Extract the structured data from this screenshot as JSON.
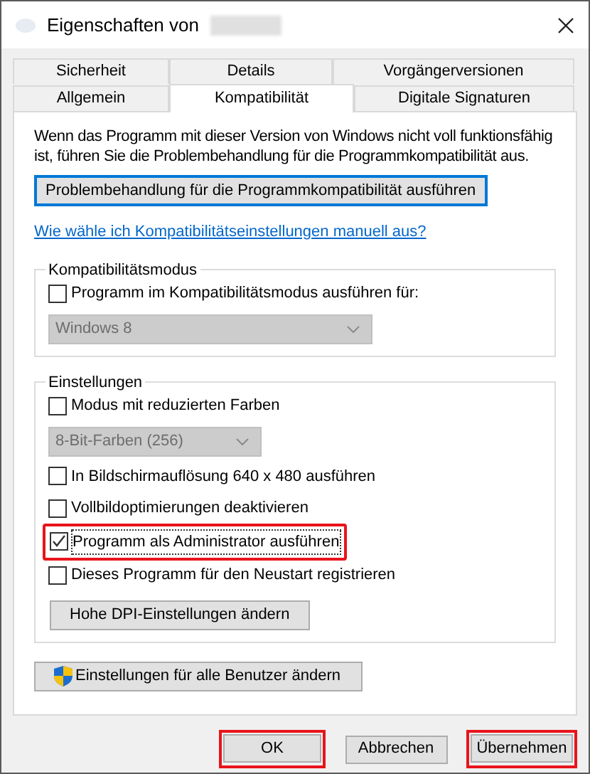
{
  "window": {
    "title": "Eigenschaften von"
  },
  "tab_rows": [
    [
      {
        "label": "Sicherheit",
        "selected": false
      },
      {
        "label": "Details",
        "selected": false
      },
      {
        "label": "Vorgängerversionen",
        "selected": false
      }
    ],
    [
      {
        "label": "Allgemein",
        "selected": false
      },
      {
        "label": "Kompatibilität",
        "selected": true
      },
      {
        "label": "Digitale Signaturen",
        "selected": false
      }
    ]
  ],
  "description": "Wenn das Programm mit dieser Version von Windows nicht voll funktionsfähig ist, führen Sie die Problembehandlung für die Programmkompatibilität aus.",
  "troubleshoot_button": "Problembehandlung für die Programmkompatibilität ausführen",
  "help_link": "Wie wähle ich Kompatibilitätseinstellungen manuell aus?",
  "groups": [
    {
      "title": "Kompatibilitätsmodus",
      "items": [
        {
          "kind": "checkbox",
          "label": "Programm im Kompatibilitätsmodus ausführen für:",
          "checked": false,
          "highlighted": false
        },
        {
          "kind": "dropdown",
          "value": "Windows 8",
          "disabled": true
        }
      ]
    },
    {
      "title": "Einstellungen",
      "items": [
        {
          "kind": "checkbox",
          "label": "Modus mit reduzierten Farben",
          "checked": false,
          "highlighted": false
        },
        {
          "kind": "dropdown",
          "value": "8-Bit-Farben (256)",
          "disabled": true
        },
        {
          "kind": "checkbox",
          "label": "In Bildschirmauflösung 640 x 480 ausführen",
          "checked": false,
          "highlighted": false
        },
        {
          "kind": "checkbox",
          "label": "Vollbildoptimierungen deaktivieren",
          "checked": false,
          "highlighted": false
        },
        {
          "kind": "checkbox",
          "label": "Programm als Administrator ausführen",
          "checked": true,
          "highlighted": true
        },
        {
          "kind": "checkbox",
          "label": "Dieses Programm für den Neustart registrieren",
          "checked": false,
          "highlighted": false
        },
        {
          "kind": "button",
          "label": "Hohe DPI-Einstellungen ändern"
        }
      ]
    }
  ],
  "all_users_button": "Einstellungen für alle Benutzer ändern",
  "buttons": [
    {
      "label": "OK",
      "highlighted": true
    },
    {
      "label": "Abbrechen",
      "highlighted": false
    },
    {
      "label": "Übernehmen",
      "highlighted": true
    }
  ]
}
